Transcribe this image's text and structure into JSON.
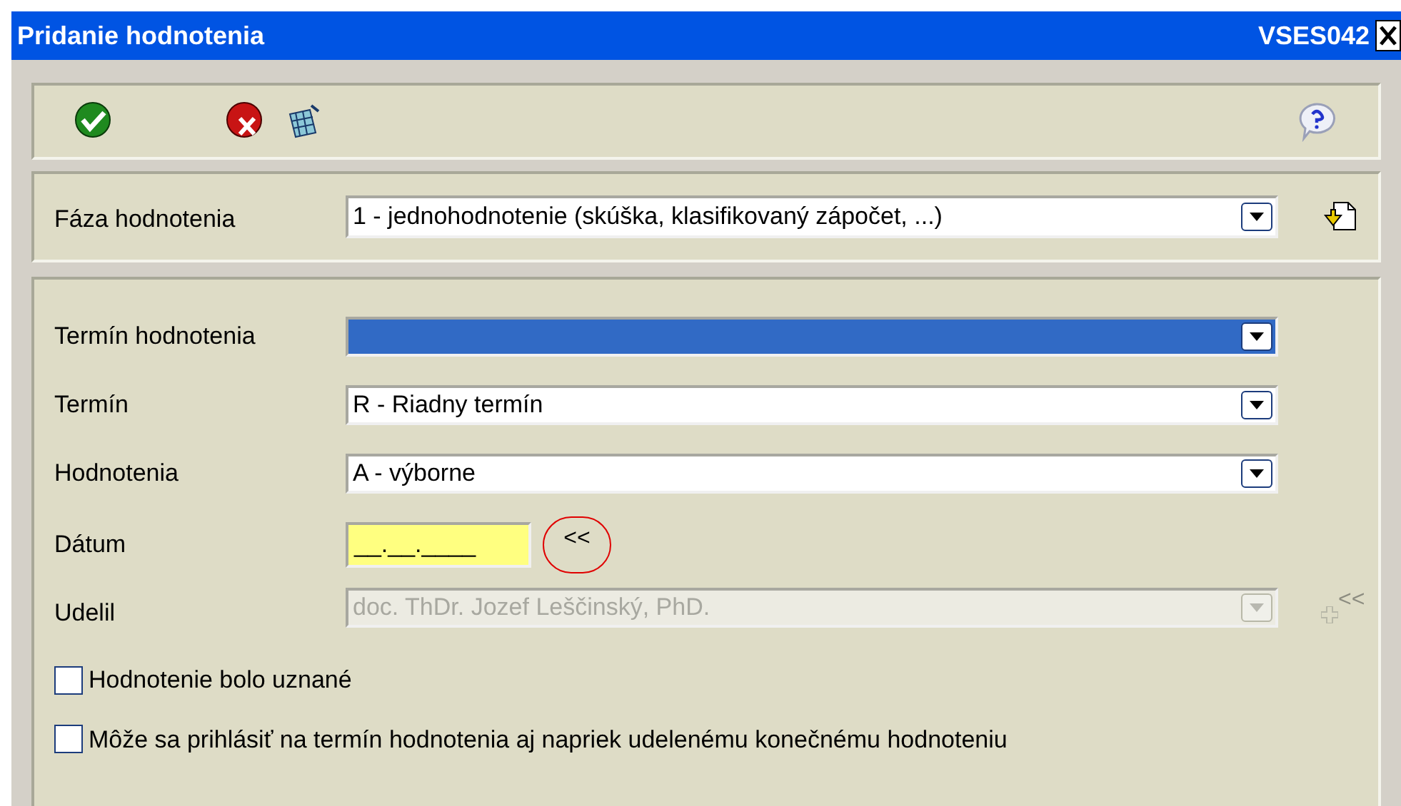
{
  "window": {
    "title": "Pridanie hodnotenia",
    "code": "VSES042"
  },
  "phase": {
    "label": "Fáza hodnotenia",
    "value": "1 - jednohodnotenie (skúška, klasifikovaný zápočet, ...)"
  },
  "fields": [
    {
      "kind": "select",
      "label": "Termín hodnotenia",
      "selected": true,
      "disabled": false
    },
    {
      "kind": "select",
      "label": "Termín",
      "value": "R - Riadny termín",
      "selected": false,
      "disabled": false
    },
    {
      "kind": "select",
      "label": "Hodnotenia",
      "value": "A - výborne",
      "selected": false,
      "disabled": false
    },
    {
      "kind": "date",
      "label": "Dátum",
      "value": "__.__.____",
      "button": "<<"
    },
    {
      "kind": "select",
      "label": "Udelil",
      "value": "doc. ThDr. Jozef Leščinský, PhD.",
      "selected": false,
      "disabled": true,
      "button": "<<"
    }
  ],
  "checkboxes": [
    {
      "label": "Hodnotenie bolo uznané",
      "checked": false
    },
    {
      "label": "Môže sa prihlásiť na termín hodnotenia aj napriek udelenému konečnému hodnoteniu",
      "checked": false
    }
  ]
}
